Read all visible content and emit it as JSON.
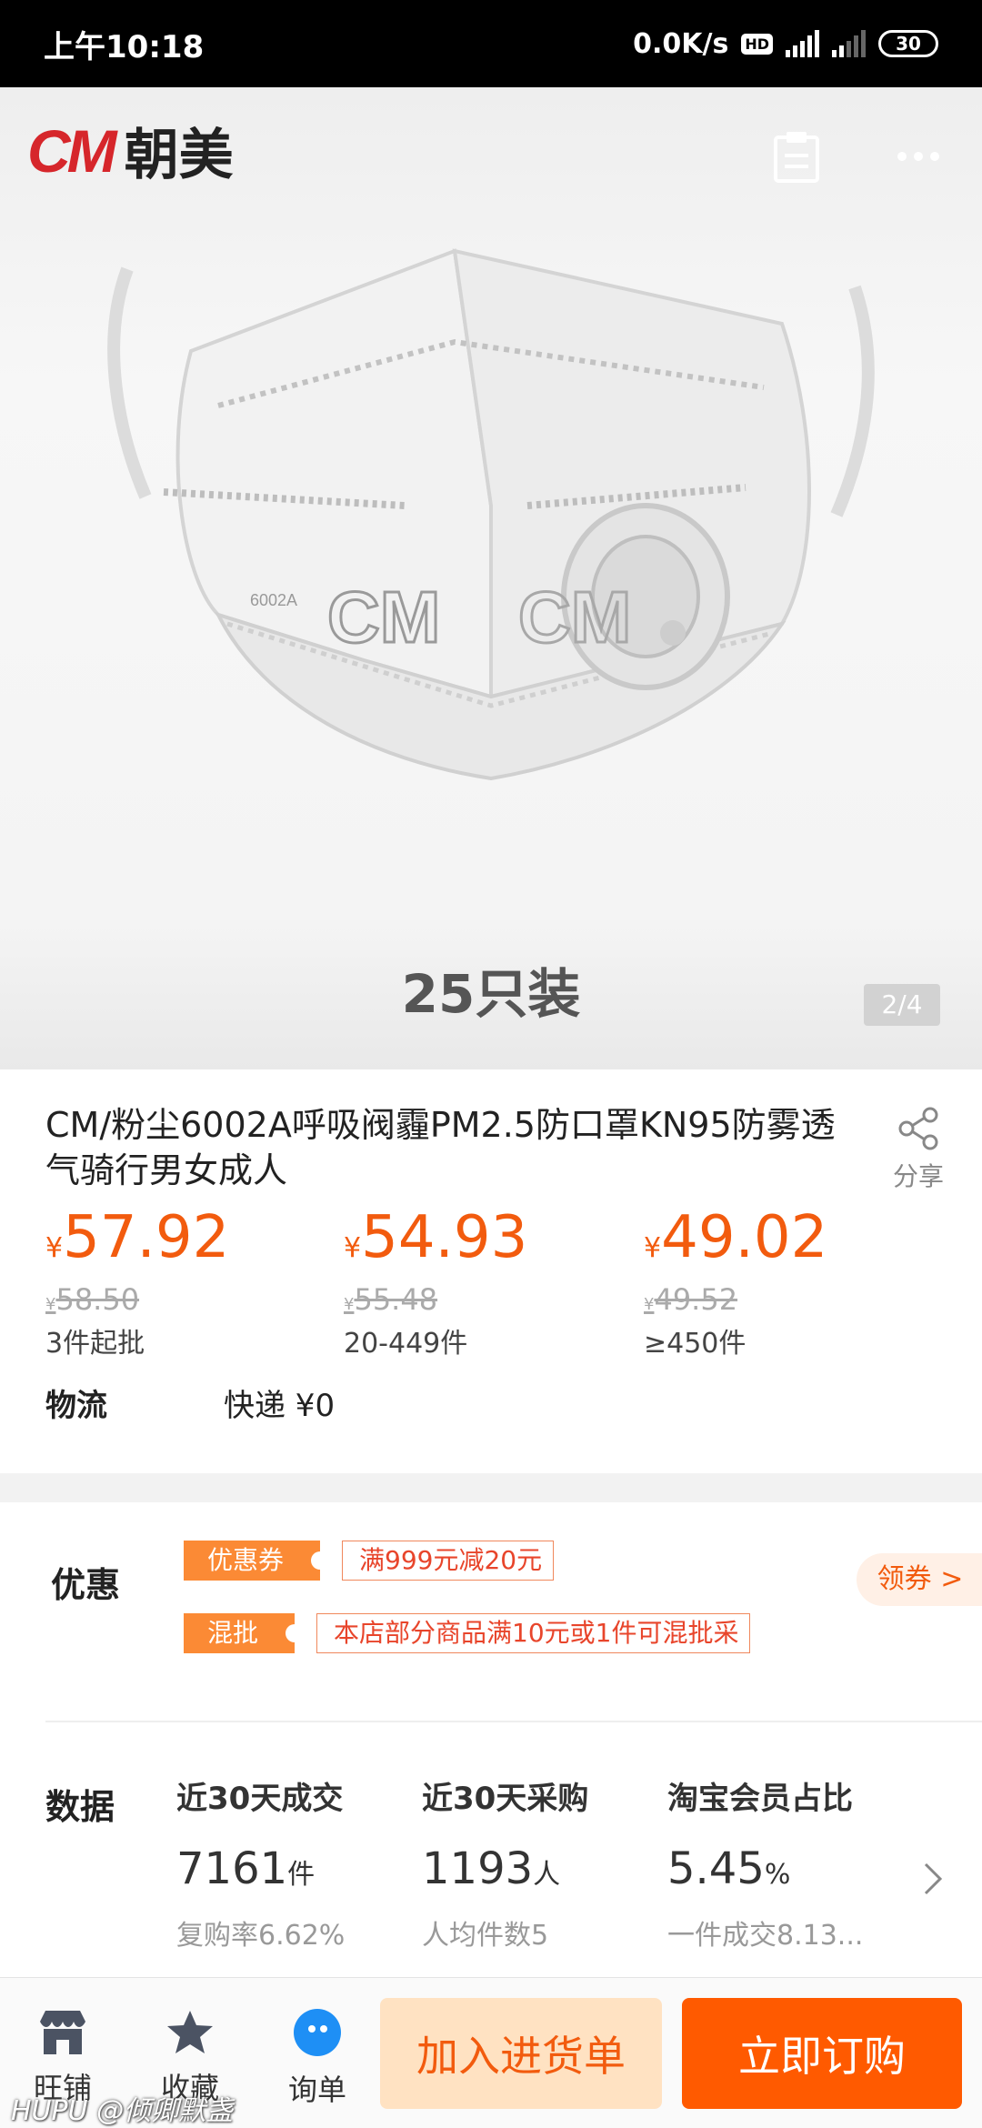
{
  "status_bar": {
    "time": "上午10:18",
    "network_speed": "0.0K/s",
    "hd_badge": "HD",
    "signal1_tag": "4G",
    "signal2_tag": "4G",
    "battery": "30"
  },
  "header": {
    "brand_latin": "CM",
    "brand_cn": "朝美"
  },
  "hero": {
    "mask_text": "CM",
    "mask_model": "6002A",
    "pack_label": "25只装",
    "page_indicator": "2/4"
  },
  "product": {
    "title": "CM/粉尘6002A呼吸阀霾PM2.5防口罩KN95防雾透气骑行男女成人",
    "share_label": "分享",
    "currency": "¥",
    "prices": [
      {
        "price": "57.92",
        "old_price": "58.50",
        "qty": "3件起批"
      },
      {
        "price": "54.93",
        "old_price": "55.48",
        "qty": "20-449件"
      },
      {
        "price": "49.02",
        "old_price": "49.52",
        "qty": "≥450件"
      }
    ],
    "logistics_label": "物流",
    "logistics_value": "快递 ¥0"
  },
  "promo": {
    "label": "优惠",
    "coupon_tag": "优惠券",
    "coupon_text": "满999元减20元",
    "mix_tag": "混批",
    "mix_text": "本店部分商品满10元或1件可混批采",
    "get_coupon": "领券 >"
  },
  "stats": {
    "label": "数据",
    "columns": [
      {
        "head": "近30天成交",
        "value": "7161",
        "unit": "件",
        "sub": "复购率6.62%"
      },
      {
        "head": "近30天采购",
        "value": "1193",
        "unit": "人",
        "sub": "人均件数5"
      },
      {
        "head": "淘宝会员占比",
        "value": "5.45",
        "unit": "%",
        "sub": "一件成交8.13..."
      }
    ]
  },
  "bottom_bar": {
    "shop": "旺铺",
    "favorite": "收藏",
    "inquiry": "询单",
    "add_to_cart": "加入进货单",
    "buy_now": "立即订购"
  },
  "watermark": "HUPU @倾卿默盏",
  "colors": {
    "accent": "#ff5a00",
    "price": "#f25b0e",
    "brand_red": "#d6262b",
    "chat_blue": "#1e8ff5"
  }
}
